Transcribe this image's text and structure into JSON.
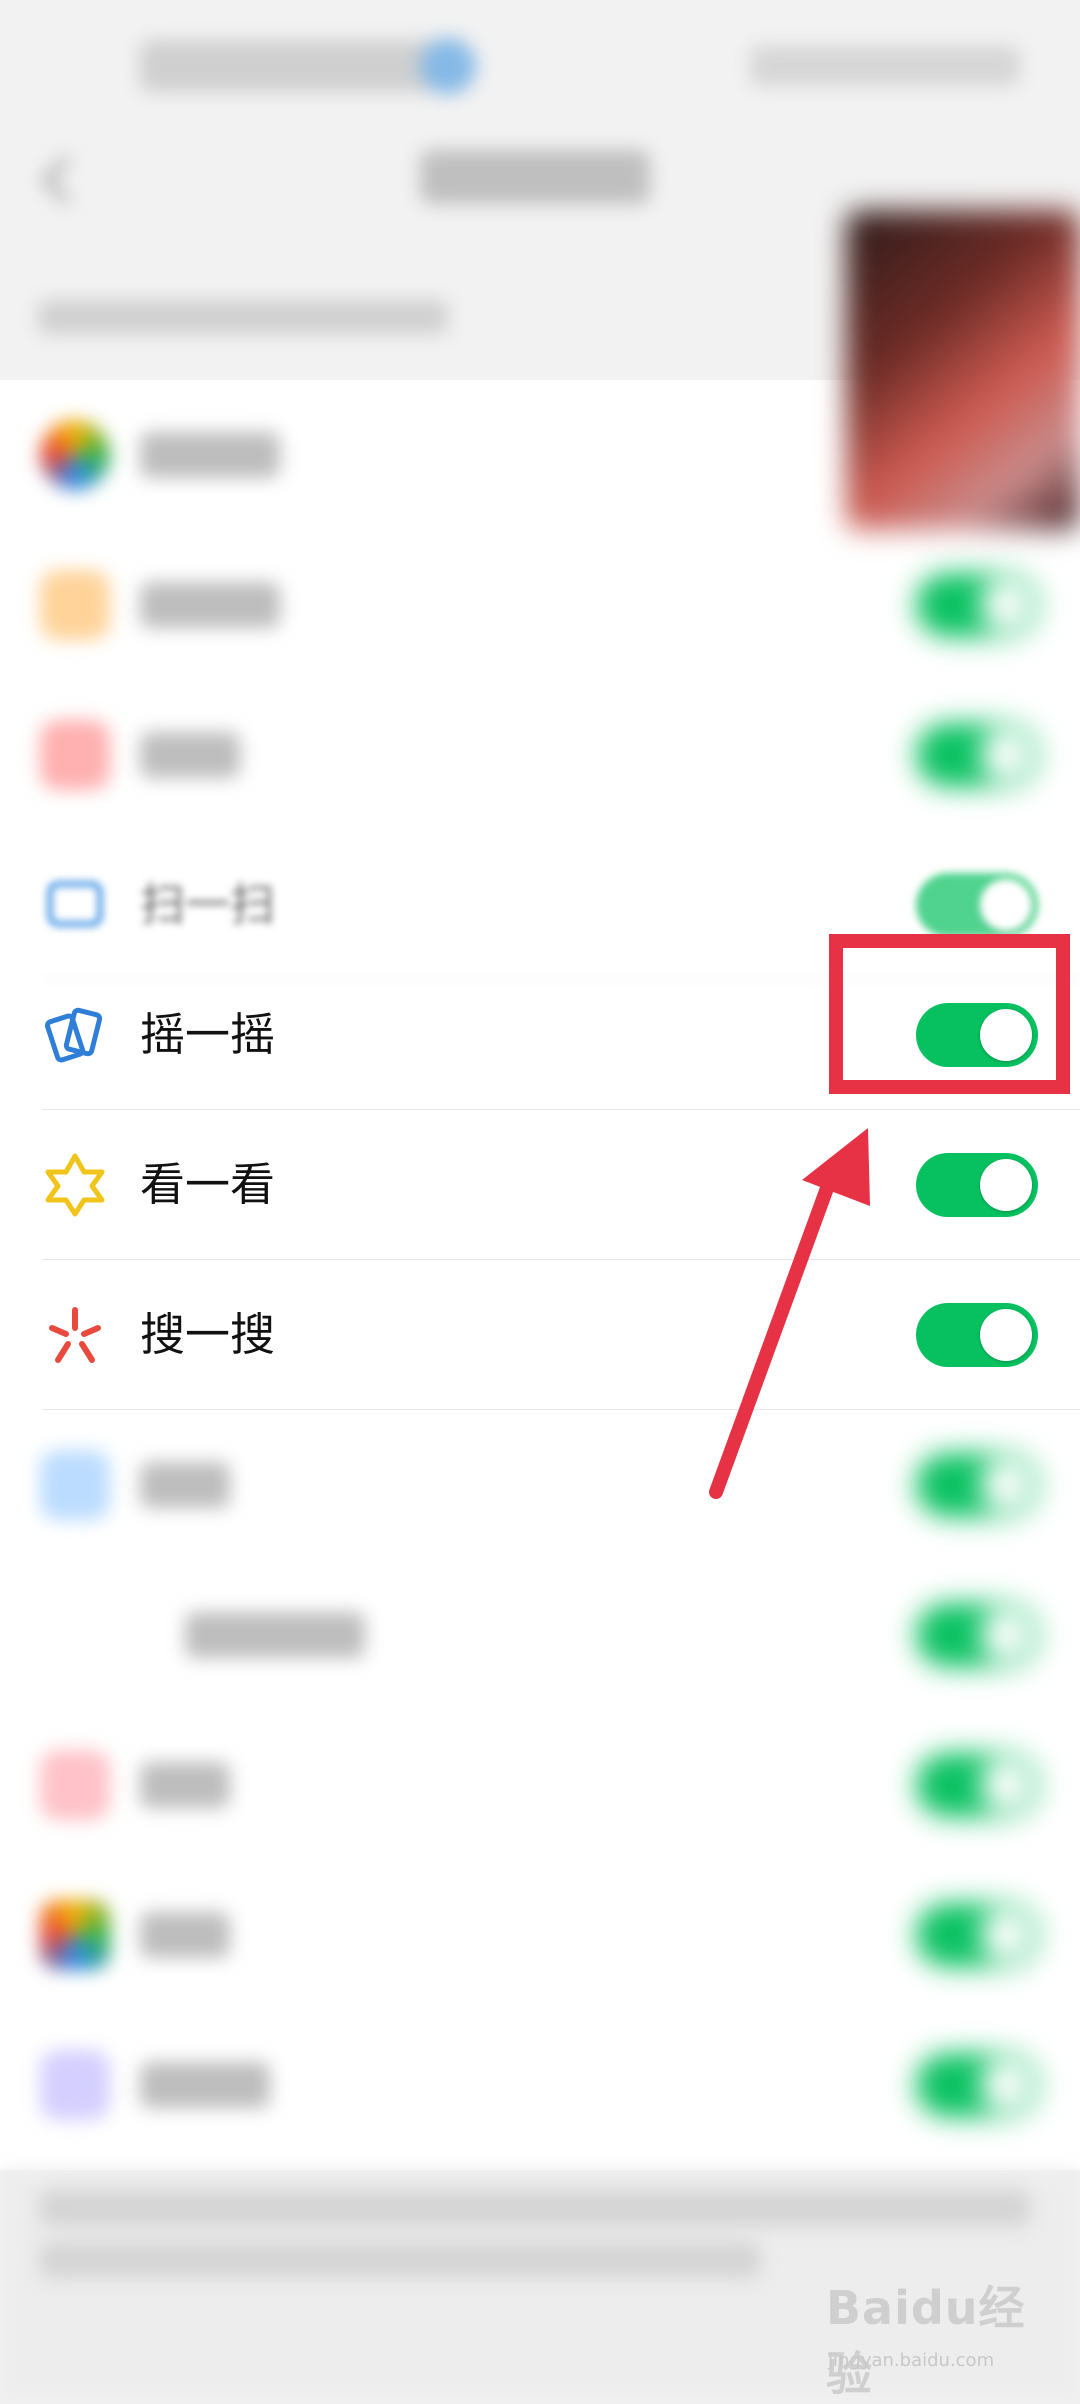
{
  "settings_list": {
    "items": [
      {
        "label": "摇一摇",
        "enabled": true,
        "icon": "shake-icon"
      },
      {
        "label": "看一看",
        "enabled": true,
        "icon": "top-stories-icon"
      },
      {
        "label": "搜一搜",
        "enabled": true,
        "icon": "search-sparkle-icon"
      }
    ],
    "partially_visible_items": [
      {
        "label": "扫一扫",
        "enabled": true,
        "icon": "scan-icon"
      }
    ]
  },
  "watermark": {
    "logo": "Baidu经验",
    "url": "jingyan.baidu.com"
  },
  "colors": {
    "toggle_on": "#07c160",
    "highlight": "#e63244",
    "list_background": "#ffffff"
  }
}
